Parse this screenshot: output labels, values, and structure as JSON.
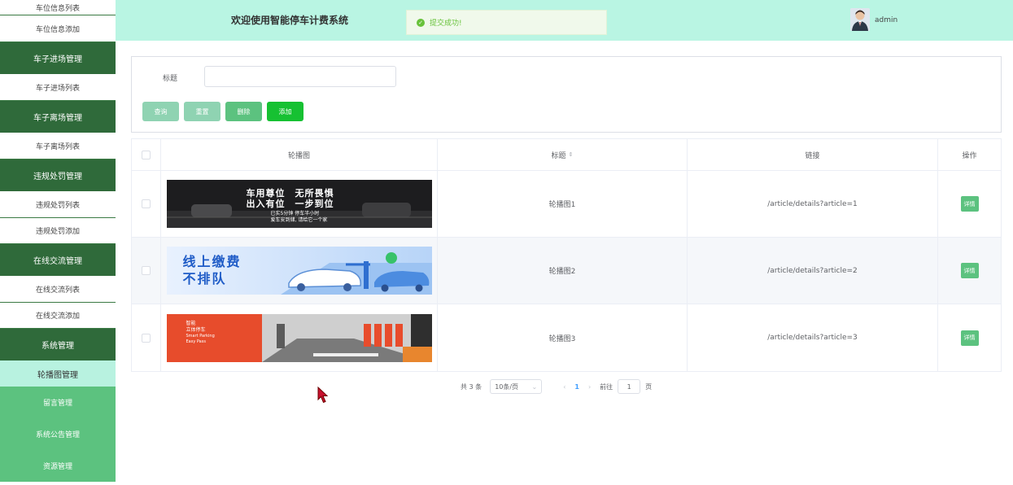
{
  "sidebar": {
    "items": [
      {
        "label": "车位信息列表",
        "style": "sub",
        "h": 19
      },
      {
        "label": "车位信息添加",
        "style": "sub",
        "h": 33
      },
      {
        "label": "车子进场管理",
        "style": "grp",
        "h": 39
      },
      {
        "label": "车子进场列表",
        "style": "sub",
        "h": 33
      },
      {
        "label": "车子离场管理",
        "style": "grp",
        "h": 39
      },
      {
        "label": "车子离场列表",
        "style": "sub",
        "h": 33
      },
      {
        "label": "违规处罚管理",
        "style": "grp",
        "h": 39
      },
      {
        "label": "违规处罚列表",
        "style": "sub",
        "h": 33
      },
      {
        "label": "违规处罚添加",
        "style": "sub",
        "h": 32
      },
      {
        "label": "在线交流管理",
        "style": "grp",
        "h": 39
      },
      {
        "label": "在线交流列表",
        "style": "sub",
        "h": 33
      },
      {
        "label": "在线交流添加",
        "style": "sub",
        "h": 32
      },
      {
        "label": "系统管理",
        "style": "grp",
        "h": 39
      },
      {
        "label": "轮播图管理",
        "style": "active",
        "h": 32
      },
      {
        "label": "留言管理",
        "style": "green",
        "h": 39
      },
      {
        "label": "系统公告管理",
        "style": "green",
        "h": 39
      },
      {
        "label": "资源管理",
        "style": "green",
        "h": 39
      }
    ]
  },
  "header": {
    "title": "欢迎使用智能停车计费系统",
    "toast": "提交成功!",
    "username": "admin"
  },
  "search": {
    "label": "标题",
    "value": "",
    "placeholder": "",
    "buttons": {
      "query": "查询",
      "reset": "重置",
      "delete": "删除",
      "add": "添加"
    }
  },
  "colors": {
    "query_btn": "#8fd3b2",
    "reset_btn": "#8fd3b2",
    "delete_btn": "#5cc27f",
    "add_btn": "#16c132",
    "sidebar_group": "#2f6a3a",
    "header_bg": "#b9f5e3"
  },
  "table": {
    "headers": {
      "image": "轮播图",
      "title": "标题",
      "link": "链接",
      "action": "操作"
    },
    "rows": [
      {
        "banner": {
          "line1": "车用尊位　无所畏惧",
          "line2": "出入有位　一步到位",
          "line3": "已实5分钟 停车半小时",
          "line4": "爱车安到储, 请给它一个家"
        },
        "title": "轮播图1",
        "link": "/article/details?article=1",
        "action": "详情"
      },
      {
        "banner": {
          "line1": "线上缴费",
          "line2": "不排队"
        },
        "title": "轮播图2",
        "link": "/article/details?article=2",
        "action": "详情"
      },
      {
        "banner": {
          "line1": "智能",
          "line2": "立体停车",
          "line3": "Smart Parking",
          "line4": "Easy Pass"
        },
        "title": "轮播图3",
        "link": "/article/details?article=3",
        "action": "详情"
      }
    ]
  },
  "pagination": {
    "total": "共 3 条",
    "page_size": "10条/页",
    "current_page": "1",
    "goto_prefix": "前往",
    "goto_value": "1",
    "goto_suffix": "页"
  }
}
